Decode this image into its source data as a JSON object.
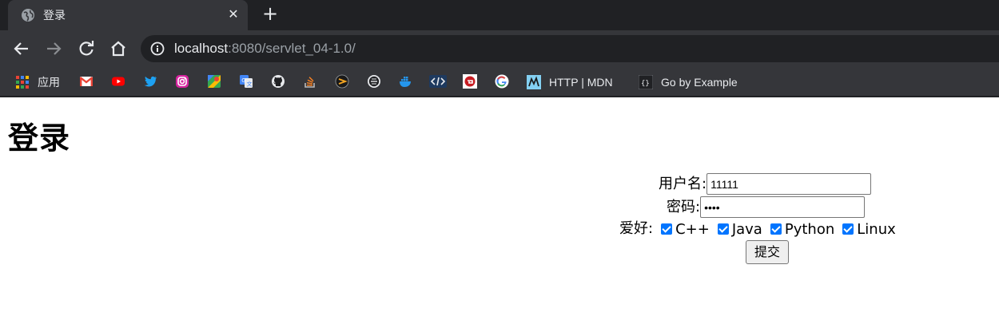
{
  "tab": {
    "title": "登录",
    "favicon": "globe-icon"
  },
  "toolbar": {
    "url_host": "localhost",
    "url_rest": ":8080/servlet_04-1.0/"
  },
  "bookmarks": {
    "apps_label": "应用",
    "mdn_label": "HTTP | MDN",
    "gobyexample_label": "Go by Example"
  },
  "page": {
    "heading": "登录",
    "username_label": "用户名:",
    "username_value": "11111",
    "password_label": "密码:",
    "password_value": "••••",
    "hobby_label": "爱好:",
    "hobbies": [
      "C++",
      "Java",
      "Python",
      "Linux"
    ],
    "submit_label": "提交"
  },
  "colors": {
    "chrome_dark": "#202124",
    "chrome_mid": "#35363a",
    "checkbox_accent": "#0075ff"
  }
}
